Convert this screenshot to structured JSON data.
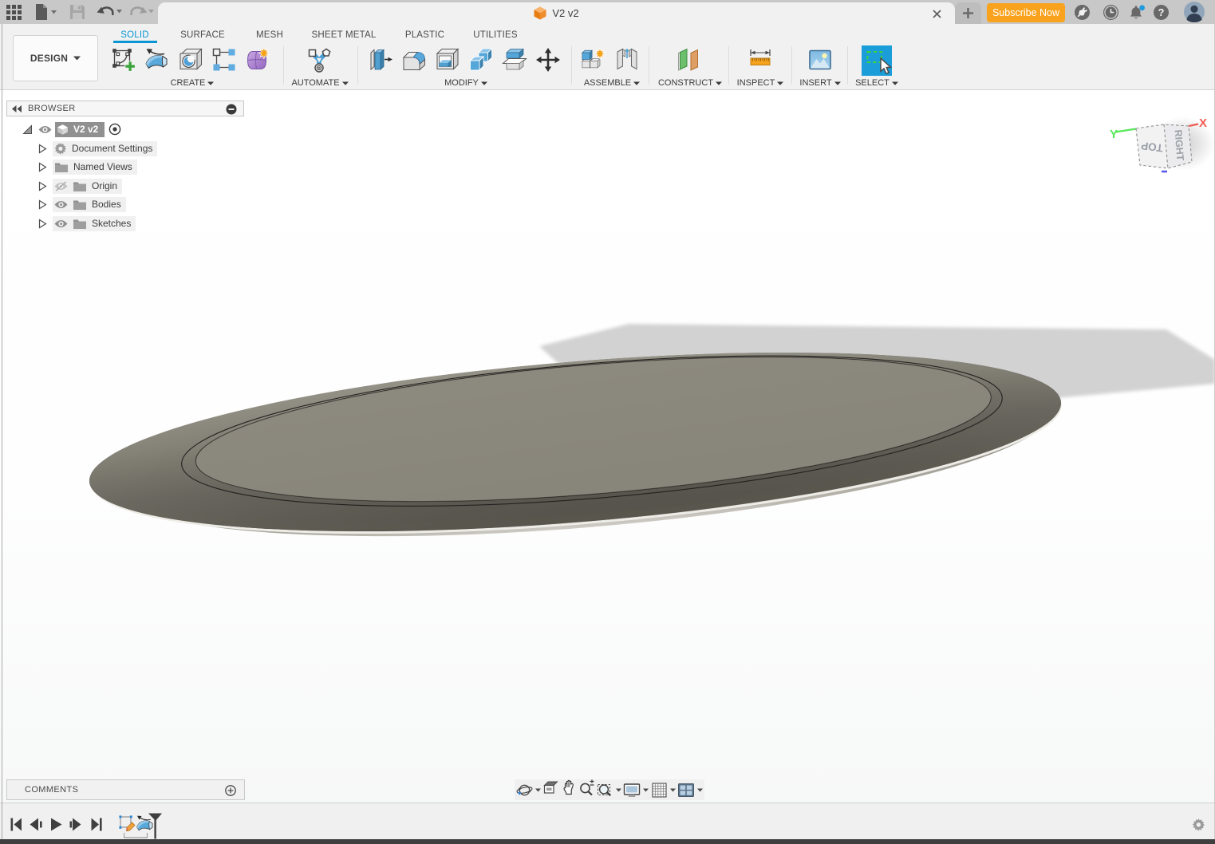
{
  "titlebar": {
    "document_tab": {
      "title": "V2 v2",
      "icon": "cube-icon"
    },
    "subscribe_label": "Subscribe Now",
    "left_icons": [
      "app-grid-icon",
      "file-new-icon",
      "save-icon",
      "undo-icon",
      "redo-icon"
    ],
    "right_icons": [
      "job-status-icon",
      "history-clock-icon",
      "notifications-bell-icon",
      "help-icon",
      "user-avatar"
    ],
    "notification_dot_color": "#1f9ade"
  },
  "ribbon": {
    "design_label": "DESIGN",
    "tabs": [
      {
        "label": "SOLID",
        "active": true
      },
      {
        "label": "SURFACE",
        "active": false
      },
      {
        "label": "MESH",
        "active": false
      },
      {
        "label": "SHEET METAL",
        "active": false
      },
      {
        "label": "PLASTIC",
        "active": false
      },
      {
        "label": "UTILITIES",
        "active": false
      }
    ],
    "groups": [
      {
        "label": "CREATE",
        "tools": [
          "create-sketch-icon",
          "revolve-icon",
          "hole-icon",
          "rectangular-pattern-icon",
          "create-form-icon"
        ]
      },
      {
        "label": "AUTOMATE",
        "tools": [
          "configure-icon"
        ]
      },
      {
        "label": "MODIFY",
        "tools": [
          "press-pull-icon",
          "fillet-icon",
          "shell-icon",
          "combine-icon",
          "split-body-icon",
          "move-copy-icon"
        ]
      },
      {
        "label": "ASSEMBLE",
        "tools": [
          "new-component-icon",
          "joint-icon"
        ]
      },
      {
        "label": "CONSTRUCT",
        "tools": [
          "construction-plane-icon"
        ]
      },
      {
        "label": "INSPECT",
        "tools": [
          "measure-icon"
        ]
      },
      {
        "label": "INSERT",
        "tools": [
          "insert-canvas-icon"
        ]
      },
      {
        "label": "SELECT",
        "tools": [
          "window-select-icon"
        ],
        "active": true
      }
    ],
    "accent_color": "#0a96d4",
    "select_button_color": "#1a9dd9"
  },
  "browser": {
    "title": "BROWSER",
    "root": {
      "label": "V2 v2",
      "selected": true,
      "icon": "component-cube-icon"
    },
    "items": [
      {
        "label": "Document Settings",
        "icon": "gear-icon",
        "eye": "none"
      },
      {
        "label": "Named Views",
        "icon": "folder-icon",
        "eye": "none"
      },
      {
        "label": "Origin",
        "icon": "folder-icon",
        "eye": "off"
      },
      {
        "label": "Bodies",
        "icon": "folder-icon",
        "eye": "on"
      },
      {
        "label": "Sketches",
        "icon": "folder-icon",
        "eye": "on"
      }
    ]
  },
  "viewcube": {
    "top_label": "TOP",
    "right_label": "RIGHT",
    "x_label": "X",
    "y_label": "Y",
    "x_color": "#f05a50",
    "y_color": "#58e75b",
    "z_color": "#5b5bf0"
  },
  "comments": {
    "label": "COMMENTS",
    "add_icon": "add-comment-icon"
  },
  "navbar_icons": [
    "orbit-icon",
    "look-at-icon",
    "pan-icon",
    "zoom-icon",
    "fit-icon",
    "display-settings-icon",
    "grid-icon",
    "viewports-icon"
  ],
  "timeline": {
    "playback_icons": [
      "skip-to-start-icon",
      "step-back-icon",
      "play-icon",
      "step-forward-icon",
      "skip-to-end-icon"
    ],
    "features": [
      "sketch-feature-icon",
      "revolve-feature-icon"
    ],
    "settings_icon": "gear-icon"
  },
  "scene": {
    "object": "flat circular plate viewed at shallow angle",
    "body_color": "#8b887d",
    "shadow_color": "#d2d2d2"
  }
}
